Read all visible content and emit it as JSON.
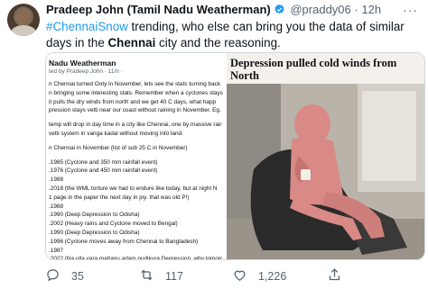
{
  "tweet": {
    "author_name": "Pradeep John (Tamil Nadu Weatherman)",
    "handle": "@praddy06",
    "separator": "·",
    "time": "12h",
    "text_part1": "#ChennaiSnow",
    "text_part2": " trending, who else can bring you the data of similar days in the ",
    "text_part3": "Chennai",
    "text_part4": " city and the reasoning."
  },
  "media": {
    "left": {
      "account_name": "Nadu Weatherman",
      "meta": "ted by Pradeep John · 11m ·",
      "lines": [
        "n Chennai turned Ooty in November, lets see the stats turning back",
        "n bringing some interesting stats. Remember when a cyclones stays",
        "it pulls the dry winds from north and we get 40 C days, what happ",
        "pression stays vetti near our coast without raining in November. Eg.",
        "",
        "temp will drop in day time in a city like Chennai, one by massive rair",
        "vetti system in vanga kadal without moving into land.",
        "",
        "n Chennai in November (list of sub 25 C in November)",
        "",
        ".1985 (Cyclone and 350 mm rainfall event)",
        ".1976 (Cyclone and 450 mm rainfall event)",
        ".1988",
        ".2018 (the WML torture we had to endure like today, but at night N",
        "1 page in the paper the next day in joy. that was old P!)",
        ".1988",
        ".1990 (Deep Depression to Odisha)",
        ".2002 (Heavy rains and Cyclone moved to Bengal)",
        ".1990 (Deep Depression to Odisha)",
        ".1996 (Cyclone moves away from Chennai to Bangladesh)",
        ".1987",
        ".2022 (Na ulla vara mattanu adam pudikura Depression, why tomorr",
        "ll go as tomorrow max in record books)"
      ]
    },
    "right": {
      "title": "Depression pulled cold winds from North"
    }
  },
  "actions": {
    "reply_count": "35",
    "retweet_count": "117",
    "like_count": "1,226"
  },
  "colors": {
    "link": "#1d9bf0",
    "muted": "#536471",
    "sweater": "#d98a86"
  }
}
